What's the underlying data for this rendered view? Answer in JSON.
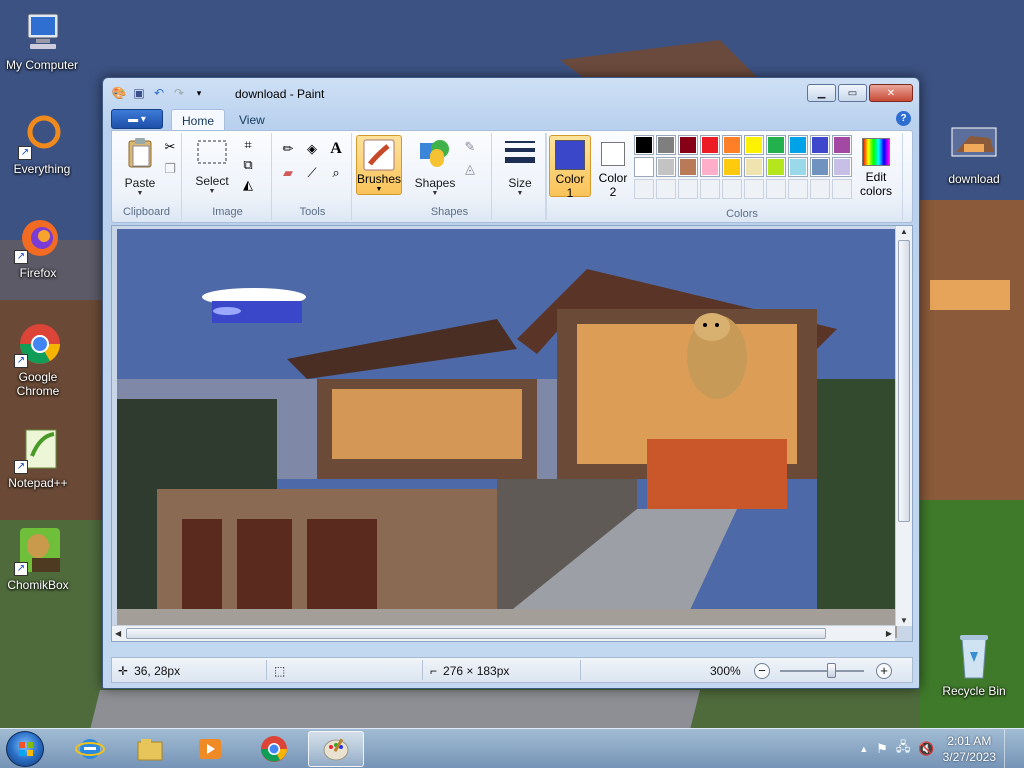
{
  "desktop": {
    "icons": [
      {
        "label": "My Computer"
      },
      {
        "label": "Everything"
      },
      {
        "label": "Firefox"
      },
      {
        "label": "Google Chrome"
      },
      {
        "label": "Notepad++"
      },
      {
        "label": "ChomikBox"
      },
      {
        "label": "download"
      },
      {
        "label": "Recycle Bin"
      }
    ]
  },
  "window": {
    "title": "download - Paint",
    "tabs": {
      "home": "Home",
      "view": "View"
    },
    "help": "?"
  },
  "ribbon": {
    "clipboard": {
      "paste": "Paste",
      "label": "Clipboard"
    },
    "image": {
      "select": "Select",
      "label": "Image"
    },
    "tools": {
      "label": "Tools"
    },
    "brushes": "Brushes",
    "shapes": {
      "button": "Shapes",
      "label": "Shapes"
    },
    "size": "Size",
    "color1": {
      "label_line1": "Color",
      "label_line2": "1",
      "value": "#3a47c8"
    },
    "color2": {
      "label_line1": "Color",
      "label_line2": "2",
      "value": "#ffffff"
    },
    "edit_colors": {
      "line1": "Edit",
      "line2": "colors"
    },
    "colors_label": "Colors",
    "palette_row1": [
      "#000000",
      "#7f7f7f",
      "#880015",
      "#ed1c24",
      "#ff7f27",
      "#fff200",
      "#22b14c",
      "#00a2e8",
      "#3f48cc",
      "#a349a4"
    ],
    "palette_row2": [
      "#ffffff",
      "#c3c3c3",
      "#b97a57",
      "#ffaec9",
      "#ffc90e",
      "#efe4b0",
      "#b5e61d",
      "#99d9ea",
      "#7092be",
      "#c8bfe7"
    ]
  },
  "statusbar": {
    "cursor_pos": "36, 28px",
    "image_size": "276 × 183px",
    "zoom": "300%",
    "zoom_level": 0.62
  },
  "taskbar": {
    "time": "2:01 AM",
    "date": "3/27/2023"
  }
}
